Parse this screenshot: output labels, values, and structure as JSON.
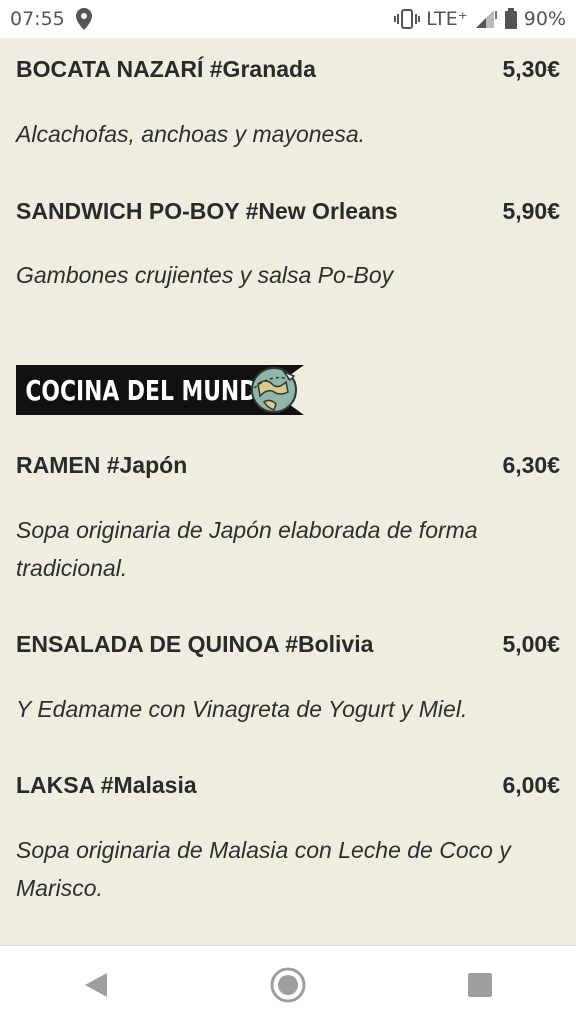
{
  "statusbar": {
    "time": "07:55",
    "network": "LTE⁺",
    "battery": "90%"
  },
  "menu": {
    "items_top": [
      {
        "name": "BOCATA NAZARÍ #Granada",
        "price": "5,30€",
        "desc": "Alcachofas, anchoas y mayonesa."
      },
      {
        "name": "SANDWICH PO-BOY #New Orleans",
        "price": "5,90€",
        "desc": "Gambones crujientes y salsa Po-Boy"
      }
    ],
    "section_title": "COCINA DEL MUNDO",
    "items_world": [
      {
        "name": "RAMEN #Japón",
        "price": "6,30€",
        "desc_l1": "Sopa originaria de Japón elaborada de forma",
        "desc_l2": "tradicional."
      },
      {
        "name": "ENSALADA DE QUINOA #Bolivia",
        "price": "5,00€",
        "desc_l1": "Y Edamame con Vinagreta de Yogurt y Miel."
      },
      {
        "name": "LAKSA #Malasia",
        "price": "6,00€",
        "desc_l1": "Sopa originaria de Malasia con Leche de Coco y",
        "desc_l2": "Marisco."
      }
    ]
  },
  "icons": {
    "location": "location-pin-icon",
    "vibrate": "vibrate-icon",
    "signal": "signal-icon",
    "battery": "battery-icon",
    "globe": "globe-plane-icon",
    "back": "back-icon",
    "home": "home-icon",
    "recents": "recents-icon"
  }
}
